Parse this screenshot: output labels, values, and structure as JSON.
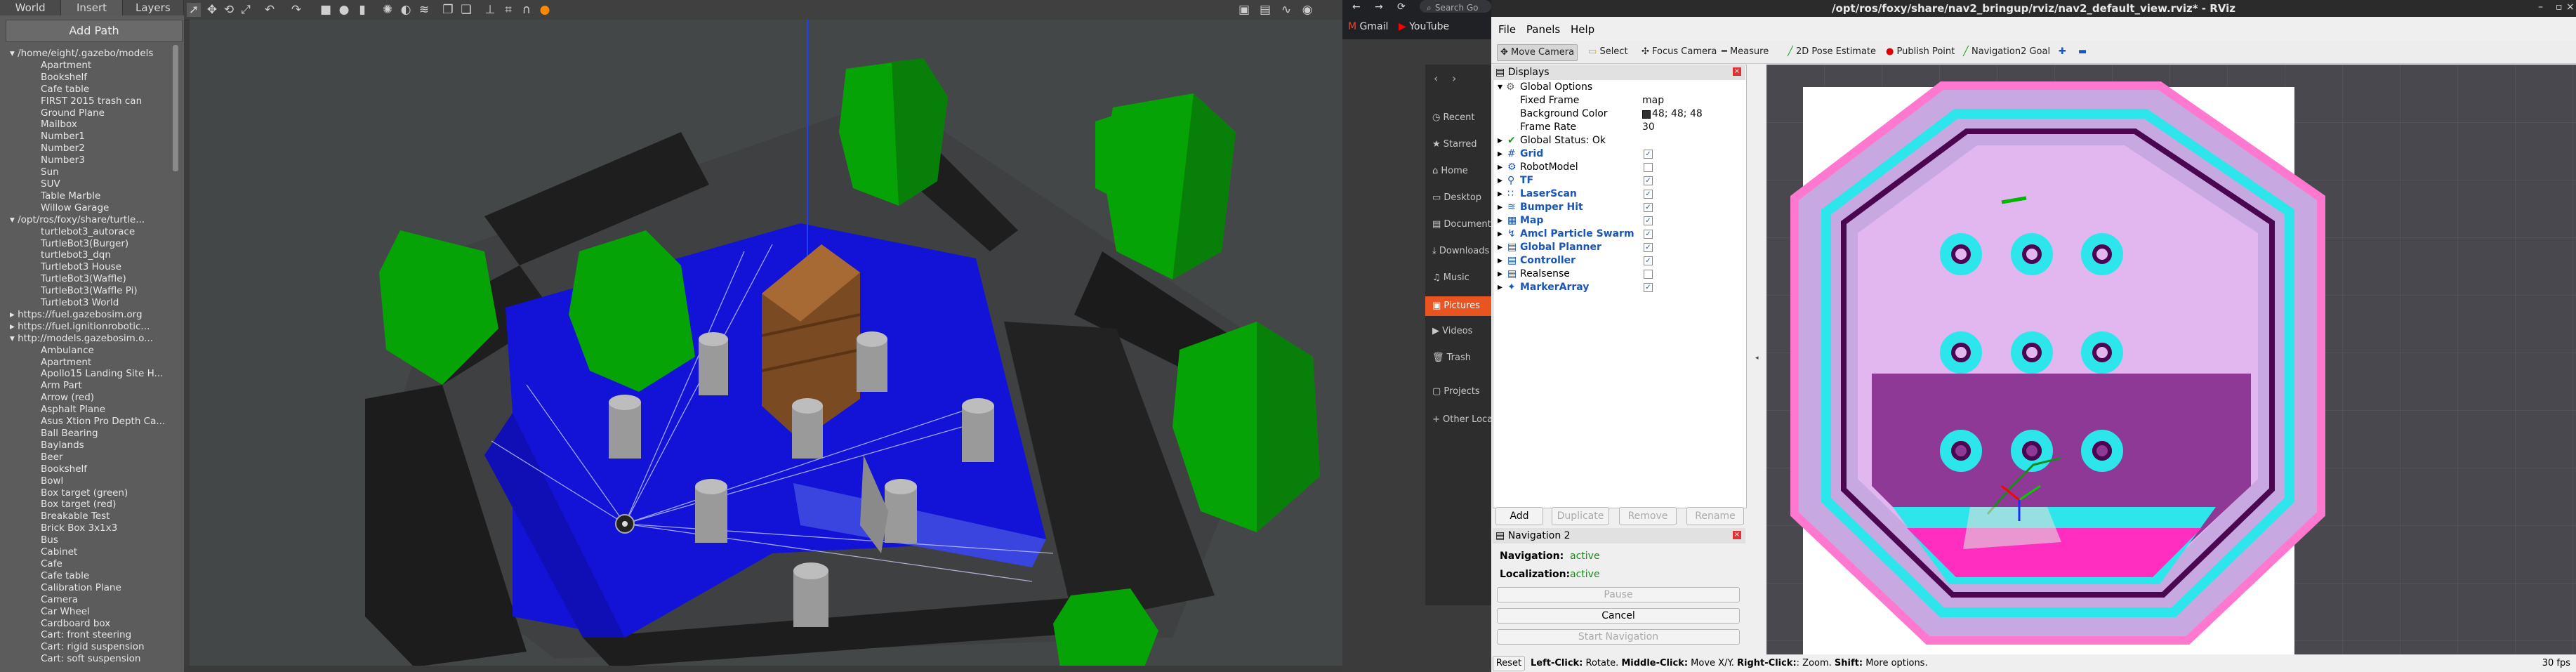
{
  "gazebo": {
    "tabs": [
      "World",
      "Insert",
      "Layers"
    ],
    "add_path": "Add Path",
    "tree": [
      {
        "kind": "r",
        "text": "▾ /home/eight/.gazebo/models"
      },
      {
        "kind": "c",
        "text": "Apartment"
      },
      {
        "kind": "c",
        "text": "Bookshelf"
      },
      {
        "kind": "c",
        "text": "Cafe table"
      },
      {
        "kind": "c",
        "text": "FIRST 2015 trash can"
      },
      {
        "kind": "c",
        "text": "Ground Plane"
      },
      {
        "kind": "c",
        "text": "Mailbox"
      },
      {
        "kind": "c",
        "text": "Number1"
      },
      {
        "kind": "c",
        "text": "Number2"
      },
      {
        "kind": "c",
        "text": "Number3"
      },
      {
        "kind": "c",
        "text": "Sun"
      },
      {
        "kind": "c",
        "text": "SUV"
      },
      {
        "kind": "c",
        "text": "Table Marble"
      },
      {
        "kind": "c",
        "text": "Willow Garage"
      },
      {
        "kind": "r",
        "text": "▾ /opt/ros/foxy/share/turtle..."
      },
      {
        "kind": "c",
        "text": "turtlebot3_autorace"
      },
      {
        "kind": "c",
        "text": "TurtleBot3(Burger)"
      },
      {
        "kind": "c",
        "text": "turtlebot3_dqn"
      },
      {
        "kind": "c",
        "text": "Turtlebot3 House"
      },
      {
        "kind": "c",
        "text": "TurtleBot3(Waffle)"
      },
      {
        "kind": "c",
        "text": "TurtleBot3(Waffle Pi)"
      },
      {
        "kind": "c",
        "text": "Turtlebot3 World"
      },
      {
        "kind": "r",
        "text": "▸ https://fuel.gazebosim.org"
      },
      {
        "kind": "r",
        "text": "▸ https://fuel.ignitionrobotic..."
      },
      {
        "kind": "r",
        "text": "▾ http://models.gazebosim.o..."
      },
      {
        "kind": "c",
        "text": "Ambulance"
      },
      {
        "kind": "c",
        "text": "Apartment"
      },
      {
        "kind": "c",
        "text": "Apollo15 Landing Site H..."
      },
      {
        "kind": "c",
        "text": "Arm Part"
      },
      {
        "kind": "c",
        "text": "Arrow (red)"
      },
      {
        "kind": "c",
        "text": "Asphalt Plane"
      },
      {
        "kind": "c",
        "text": "Asus Xtion Pro Depth Ca..."
      },
      {
        "kind": "c",
        "text": "Ball Bearing"
      },
      {
        "kind": "c",
        "text": "Baylands"
      },
      {
        "kind": "c",
        "text": "Beer"
      },
      {
        "kind": "c",
        "text": "Bookshelf"
      },
      {
        "kind": "c",
        "text": "Bowl"
      },
      {
        "kind": "c",
        "text": "Box target (green)"
      },
      {
        "kind": "c",
        "text": "Box target (red)"
      },
      {
        "kind": "c",
        "text": "Breakable Test"
      },
      {
        "kind": "c",
        "text": "Brick Box 3x1x3"
      },
      {
        "kind": "c",
        "text": "Bus"
      },
      {
        "kind": "c",
        "text": "Cabinet"
      },
      {
        "kind": "c",
        "text": "Cafe"
      },
      {
        "kind": "c",
        "text": "Cafe table"
      },
      {
        "kind": "c",
        "text": "Calibration Plane"
      },
      {
        "kind": "c",
        "text": "Camera"
      },
      {
        "kind": "c",
        "text": "Car Wheel"
      },
      {
        "kind": "c",
        "text": "Cardboard box"
      },
      {
        "kind": "c",
        "text": "Cart: front steering"
      },
      {
        "kind": "c",
        "text": "Cart: rigid suspension"
      },
      {
        "kind": "c",
        "text": "Cart: soft suspension"
      }
    ]
  },
  "browser": {
    "search_placeholder": "Search Go",
    "bookmarks": [
      "Gmail",
      "YouTube"
    ]
  },
  "nautilus": {
    "items": [
      "Recent",
      "Starred",
      "Home",
      "Desktop",
      "Documents",
      "Downloads",
      "Music",
      "Pictures",
      "Videos",
      "Trash",
      "Projects",
      "Other Locations"
    ],
    "selected": "Pictures"
  },
  "rviz": {
    "title": "/opt/ros/foxy/share/nav2_bringup/rviz/nav2_default_view.rviz* - RViz",
    "menu": [
      "File",
      "Panels",
      "Help"
    ],
    "tools": [
      "Move Camera",
      "Select",
      "Focus Camera",
      "Measure",
      "2D Pose Estimate",
      "Publish Point",
      "Navigation2 Goal"
    ],
    "displays_title": "Displays",
    "global_options": "Global Options",
    "props": [
      {
        "label": "Fixed Frame",
        "value": "map"
      },
      {
        "label": "Background Color",
        "value": "48; 48; 48"
      },
      {
        "label": "Frame Rate",
        "value": "30"
      }
    ],
    "global_status": "Global Status: Ok",
    "displays": [
      {
        "name": "Grid",
        "checked": true,
        "active": true
      },
      {
        "name": "RobotModel",
        "checked": false,
        "active": false
      },
      {
        "name": "TF",
        "checked": true,
        "active": true
      },
      {
        "name": "LaserScan",
        "checked": true,
        "active": true
      },
      {
        "name": "Bumper Hit",
        "checked": true,
        "active": true
      },
      {
        "name": "Map",
        "checked": true,
        "active": true
      },
      {
        "name": "Amcl Particle Swarm",
        "checked": true,
        "active": true
      },
      {
        "name": "Global Planner",
        "checked": true,
        "active": true
      },
      {
        "name": "Controller",
        "checked": true,
        "active": true
      },
      {
        "name": "Realsense",
        "checked": false,
        "active": false
      },
      {
        "name": "MarkerArray",
        "checked": true,
        "active": true
      }
    ],
    "display_buttons": [
      "Add",
      "Duplicate",
      "Remove",
      "Rename"
    ],
    "nav2": {
      "title": "Navigation 2",
      "navigation_label": "Navigation:",
      "navigation_value": "active",
      "localization_label": "Localization:",
      "localization_value": "active",
      "pause": "Pause",
      "cancel": "Cancel",
      "start": "Start Navigation"
    },
    "status": {
      "reset": "Reset",
      "left": "Left-Click:",
      "left_t": " Rotate. ",
      "middle": "Middle-Click:",
      "middle_t": " Move X/Y. ",
      "right": "Right-Click:",
      "right_t": ": Zoom. ",
      "shift": "Shift:",
      "shift_t": " More options.",
      "fps": "30 fps"
    }
  }
}
